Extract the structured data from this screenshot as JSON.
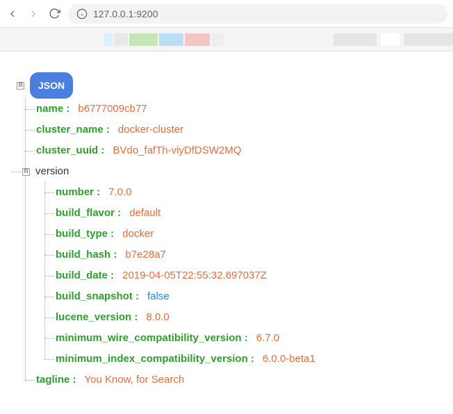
{
  "browser": {
    "url": "127.0.0.1:9200"
  },
  "tree": {
    "badge": "JSON",
    "toggle_collapse": "⊟",
    "version_label": "version",
    "items": {
      "name_key": "name :",
      "name_val": "b6777009cb77",
      "cluster_name_key": "cluster_name :",
      "cluster_name_val": "docker-cluster",
      "cluster_uuid_key": "cluster_uuid :",
      "cluster_uuid_val": "BVdo_fafTh-viyDfDSW2MQ",
      "tagline_key": "tagline :",
      "tagline_val": "You Know, for Search"
    },
    "version": {
      "number_key": "number :",
      "number_val": "7.0.0",
      "build_flavor_key": "build_flavor :",
      "build_flavor_val": "default",
      "build_type_key": "build_type :",
      "build_type_val": "docker",
      "build_hash_key": "build_hash :",
      "build_hash_val": "b7e28a7",
      "build_date_key": "build_date :",
      "build_date_val": "2019-04-05T22:55:32.697037Z",
      "build_snapshot_key": "build_snapshot :",
      "build_snapshot_val": "false",
      "lucene_version_key": "lucene_version :",
      "lucene_version_val": "8.0.0",
      "min_wire_key": "minimum_wire_compatibility_version :",
      "min_wire_val": "6.7.0",
      "min_index_key": "minimum_index_compatibility_version :",
      "min_index_val": "6.0.0-beta1"
    }
  }
}
